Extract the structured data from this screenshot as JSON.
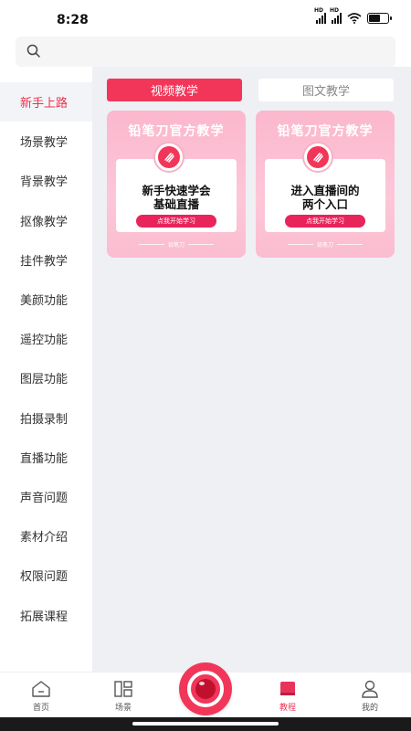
{
  "status": {
    "time": "8:28",
    "battery_level": 0.6
  },
  "search": {
    "placeholder": "",
    "value": ""
  },
  "sidebar": {
    "items": [
      {
        "label": "新手上路",
        "active": true
      },
      {
        "label": "场景教学"
      },
      {
        "label": "背景教学"
      },
      {
        "label": "抠像教学"
      },
      {
        "label": "挂件教学"
      },
      {
        "label": "美颜功能"
      },
      {
        "label": "遥控功能"
      },
      {
        "label": "图层功能"
      },
      {
        "label": "拍摄录制"
      },
      {
        "label": "直播功能"
      },
      {
        "label": "声音问题"
      },
      {
        "label": "素材介绍"
      },
      {
        "label": "权限问题"
      },
      {
        "label": "拓展课程"
      }
    ]
  },
  "tabs": [
    {
      "label": "视频教学",
      "active": true
    },
    {
      "label": "图文教学",
      "active": false
    }
  ],
  "cards": [
    {
      "title": "铅笔刀官方教学",
      "headline_1": "新手快速学会",
      "headline_2": "基础直播",
      "button": "点我开始学习",
      "brand": "铅笔刀"
    },
    {
      "title": "铅笔刀官方教学",
      "headline_1": "进入直播间的",
      "headline_2": "两个入口",
      "button": "点我开始学习",
      "brand": "铅笔刀"
    }
  ],
  "nav": {
    "home": "首页",
    "scene": "场景",
    "tutorial": "教程",
    "mine": "我的",
    "active": "tutorial"
  },
  "colors": {
    "accent": "#f23659",
    "sidebar_active": "#f0304c",
    "content_bg": "#eef0f4"
  }
}
